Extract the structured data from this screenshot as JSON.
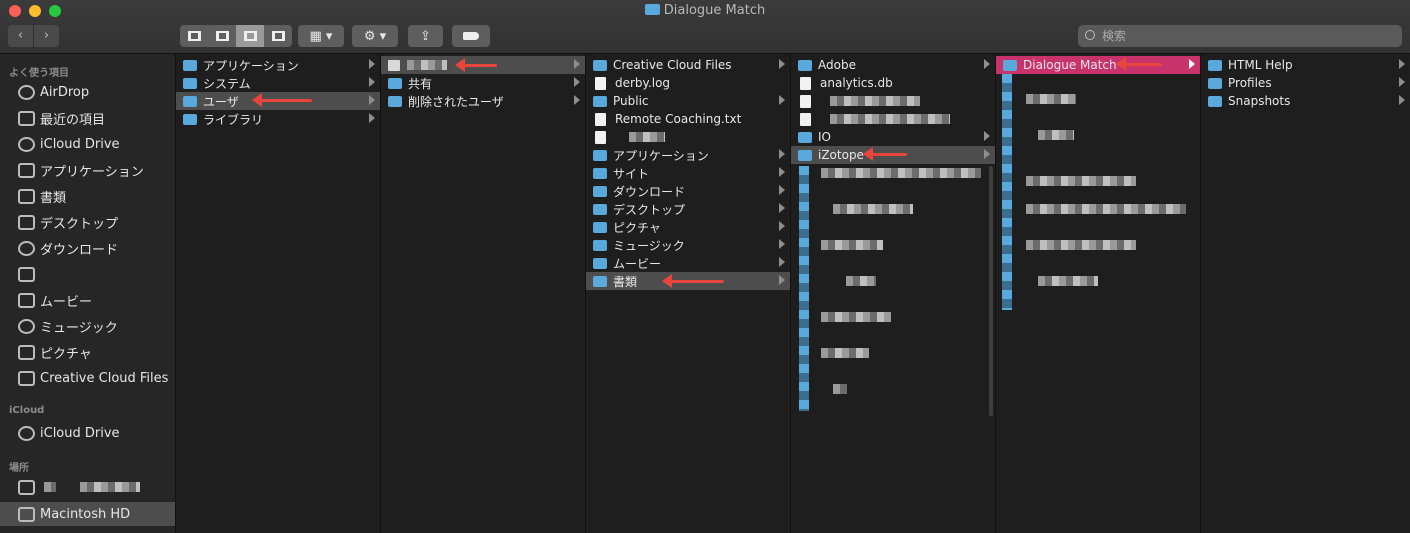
{
  "window": {
    "title": "Dialogue Match"
  },
  "toolbar": {
    "back_icon": "chevron-left-icon",
    "forward_icon": "chevron-right-icon",
    "back_label": "‹",
    "forward_label": "›",
    "share_icon": "share-icon",
    "tag_icon": "tag-icon",
    "action_icon": "gear-icon",
    "group_icon": "grid-icon",
    "search_placeholder": "検索"
  },
  "sidebar": {
    "favorites_header": "よく使う項目",
    "favorites": [
      {
        "label": "AirDrop",
        "icon": "airdrop-icon"
      },
      {
        "label": "最近の項目",
        "icon": "recents-icon"
      },
      {
        "label": "iCloud Drive",
        "icon": "cloud-icon"
      },
      {
        "label": "アプリケーション",
        "icon": "applications-icon"
      },
      {
        "label": "書類",
        "icon": "document-icon"
      },
      {
        "label": "デスクトップ",
        "icon": "desktop-icon"
      },
      {
        "label": "ダウンロード",
        "icon": "download-icon"
      },
      {
        "label": "",
        "icon": "home-icon"
      },
      {
        "label": "ムービー",
        "icon": "movie-icon"
      },
      {
        "label": "ミュージック",
        "icon": "music-icon"
      },
      {
        "label": "ピクチャ",
        "icon": "camera-icon"
      },
      {
        "label": "Creative Cloud Files",
        "icon": "folder-icon"
      }
    ],
    "icloud_header": "iCloud",
    "icloud": [
      {
        "label": "iCloud Drive",
        "icon": "cloud-icon"
      }
    ],
    "locations_header": "場所",
    "locations": [
      {
        "label": "",
        "icon": "computer-icon"
      },
      {
        "label": "Macintosh HD",
        "icon": "disk-icon"
      }
    ]
  },
  "columns": {
    "c1": [
      "アプリケーション",
      "システム",
      "ユーザ",
      "ライブラリ"
    ],
    "c2": [
      "",
      "共有",
      "削除されたユーザ"
    ],
    "c3": [
      "Creative Cloud Files",
      "derby.log",
      "Public",
      "Remote Coaching.txt",
      "",
      "アプリケーション",
      "サイト",
      "ダウンロード",
      "デスクトップ",
      "ピクチャ",
      "ミュージック",
      "ムービー",
      "書類"
    ],
    "c4": [
      "Adobe",
      "analytics.db",
      "",
      "",
      "IO",
      "iZotope"
    ],
    "c5": [
      "Dialogue Match"
    ],
    "c6": [
      "HTML Help",
      "Profiles",
      "Snapshots"
    ]
  }
}
